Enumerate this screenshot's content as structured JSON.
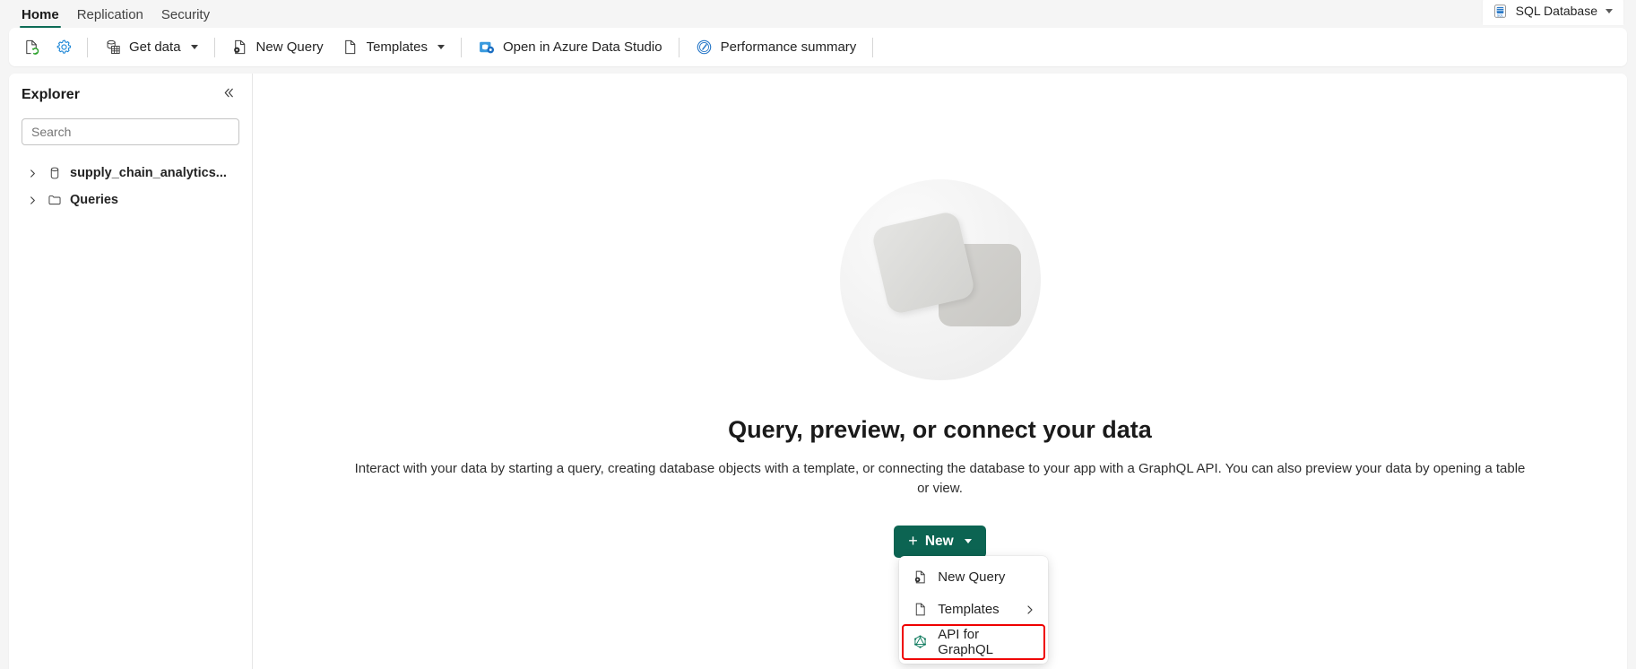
{
  "tabs": [
    {
      "label": "Home",
      "active": true
    },
    {
      "label": "Replication",
      "active": false
    },
    {
      "label": "Security",
      "active": false
    }
  ],
  "header": {
    "database_pill_label": "SQL Database",
    "database_pill_icon": "sql-database-icon"
  },
  "toolbar": {
    "refresh_icon": "refresh-page-icon",
    "settings_icon": "settings-gear-icon",
    "items": [
      {
        "label": "Get data",
        "icon": "get-data-icon",
        "has_caret": true
      },
      {
        "label": "New Query",
        "icon": "new-query-icon",
        "has_caret": false
      },
      {
        "label": "Templates",
        "icon": "templates-icon",
        "has_caret": true
      },
      {
        "label": "Open in Azure Data Studio",
        "icon": "azure-data-studio-icon",
        "has_caret": false
      },
      {
        "label": "Performance summary",
        "icon": "performance-summary-icon",
        "has_caret": false
      }
    ]
  },
  "explorer": {
    "title": "Explorer",
    "collapse_icon": "collapse-double-chevron-icon",
    "search": {
      "placeholder": "Search",
      "value": ""
    },
    "tree": [
      {
        "label": "supply_chain_analytics...",
        "icon": "database-icon",
        "expanded": false
      },
      {
        "label": "Queries",
        "icon": "folder-icon",
        "expanded": false
      }
    ]
  },
  "main": {
    "illustration": "stacked-squares-illustration",
    "title": "Query, preview, or connect your data",
    "description": "Interact with your data by starting a query, creating database objects with a template, or connecting the database to your app with a GraphQL API. You can also preview your data by opening a table or view.",
    "new_button": {
      "label": "New",
      "icon": "plus-icon",
      "caret": true
    },
    "menu": [
      {
        "label": "New Query",
        "icon": "new-query-icon",
        "submenu": false,
        "highlighted": false
      },
      {
        "label": "Templates",
        "icon": "templates-icon",
        "submenu": true,
        "highlighted": false
      },
      {
        "label": "API for GraphQL",
        "icon": "graphql-icon",
        "submenu": false,
        "highlighted": true
      }
    ]
  },
  "colors": {
    "accent_green": "#0c6452",
    "tab_underline": "#0d6b56",
    "highlight_red": "#ef0000",
    "page_background": "#f5f5f5",
    "surface": "#ffffff"
  }
}
